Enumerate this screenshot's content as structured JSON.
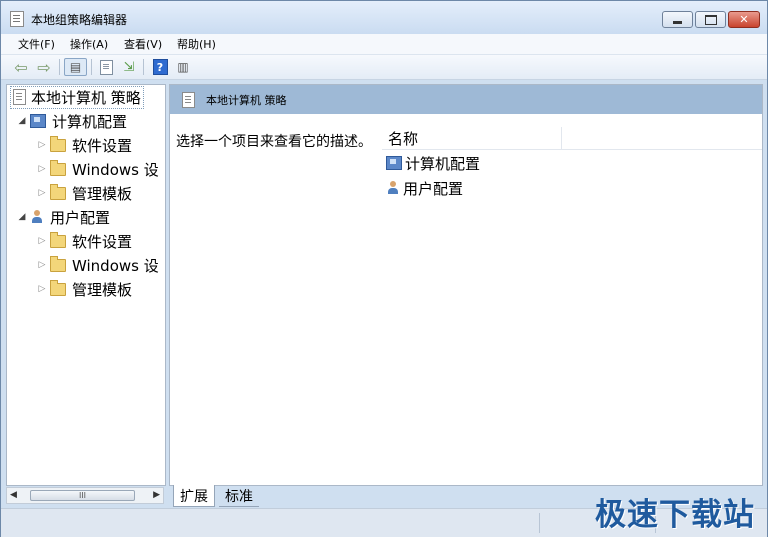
{
  "window": {
    "title": "本地组策略编辑器",
    "controls": {
      "minimize": "minimize",
      "maximize": "maximize",
      "close": "✕"
    }
  },
  "menu": [
    "文件(F)",
    "操作(A)",
    "查看(V)",
    "帮助(H)"
  ],
  "toolbar": {
    "icons": [
      "back-arrow-icon",
      "forward-arrow-icon",
      "show-hide-tree-icon",
      "properties-icon",
      "export-list-icon",
      "help-icon",
      "show-hide-action-pane-icon"
    ],
    "help_label": "?"
  },
  "tree": {
    "root": "本地计算机 策略",
    "computer": {
      "label": "计算机配置",
      "children": [
        "软件设置",
        "Windows 设",
        "管理模板"
      ]
    },
    "user": {
      "label": "用户配置",
      "children": [
        "软件设置",
        "Windows 设",
        "管理模板"
      ]
    },
    "scroll_thumb": "III"
  },
  "detail": {
    "header": "本地计算机 策略",
    "description": "选择一个项目来查看它的描述。",
    "column_name": "名称",
    "items": [
      "计算机配置",
      "用户配置"
    ]
  },
  "tabs": [
    "扩展",
    "标准"
  ],
  "watermark": "极速下载站",
  "colors": {
    "header_band": "#9eb9d6",
    "folder": "#f3d67a",
    "watermark": "#1f5a9e"
  }
}
